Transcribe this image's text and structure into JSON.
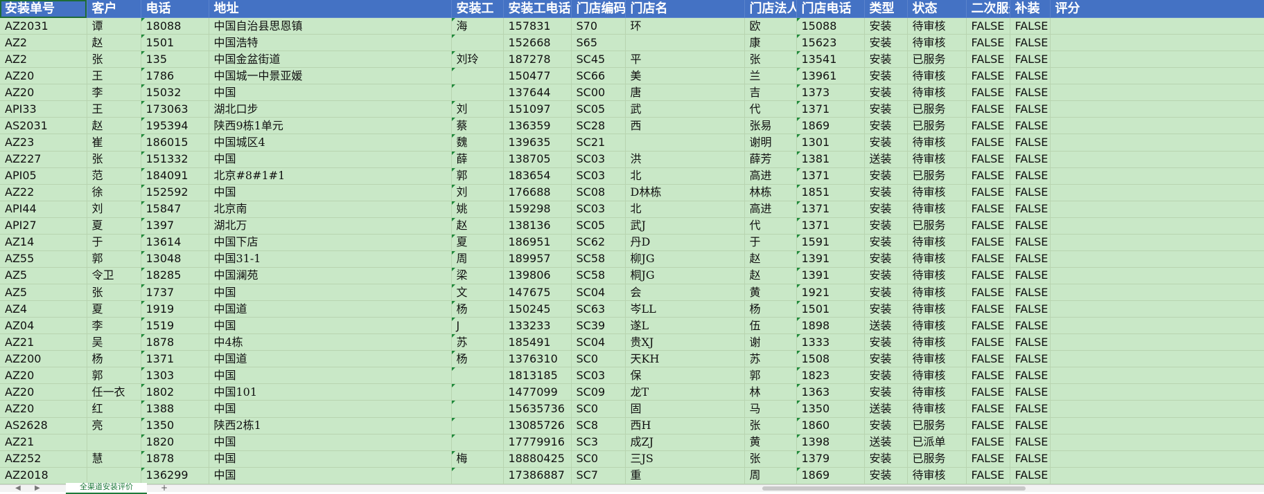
{
  "columns": [
    {
      "key": "order_no",
      "label": "安装单号"
    },
    {
      "key": "customer",
      "label": "客户"
    },
    {
      "key": "phone",
      "label": "电话"
    },
    {
      "key": "address",
      "label": "地址"
    },
    {
      "key": "installer",
      "label": "安装工"
    },
    {
      "key": "installer_phone",
      "label": "安装工电话"
    },
    {
      "key": "store_code",
      "label": "门店编码"
    },
    {
      "key": "store_name",
      "label": "门店名"
    },
    {
      "key": "legal_person",
      "label": "门店法人"
    },
    {
      "key": "store_phone",
      "label": "门店电话"
    },
    {
      "key": "type",
      "label": "类型"
    },
    {
      "key": "status",
      "label": "状态"
    },
    {
      "key": "second_service",
      "label": "二次服务"
    },
    {
      "key": "supplement",
      "label": "补装"
    },
    {
      "key": "rating",
      "label": "评分"
    }
  ],
  "rows": [
    {
      "order_no": "AZ2031",
      "customer": "谭",
      "phone": "18088",
      "address": "中国自治县思恩镇",
      "installer": "海",
      "installer_phone": "157831",
      "store_code": "S70",
      "store_name": "环",
      "legal_person": "欧",
      "store_phone": "15088",
      "type": "安装",
      "status": "待审核",
      "second_service": "FALSE",
      "supplement": "FALSE",
      "rating": ""
    },
    {
      "order_no": "AZ2",
      "customer": "赵",
      "phone": "1501",
      "address": "中国浩特",
      "installer": "",
      "installer_phone": "152668",
      "store_code": "S65",
      "store_name": "",
      "legal_person": "康",
      "store_phone": "15623",
      "type": "安装",
      "status": "待审核",
      "second_service": "FALSE",
      "supplement": "FALSE",
      "rating": ""
    },
    {
      "order_no": "AZ2",
      "customer": "张",
      "phone": "135",
      "address": "中国金盆街道",
      "installer": "刘玲",
      "installer_phone": "187278",
      "store_code": "SC45",
      "store_name": "平",
      "legal_person": "张",
      "store_phone": "13541",
      "type": "安装",
      "status": "已服务",
      "second_service": "FALSE",
      "supplement": "FALSE",
      "rating": ""
    },
    {
      "order_no": "AZ20",
      "customer": "王",
      "phone": "1786",
      "address": "中国城一中景亚媛",
      "installer": "",
      "installer_phone": "150477",
      "store_code": "SC66",
      "store_name": "美",
      "legal_person": "兰",
      "store_phone": "13961",
      "type": "安装",
      "status": "待审核",
      "second_service": "FALSE",
      "supplement": "FALSE",
      "rating": ""
    },
    {
      "order_no": "AZ20",
      "customer": "李",
      "phone": "15032",
      "address": "中国",
      "installer": "",
      "installer_phone": "137644",
      "store_code": "SC00",
      "store_name": "唐",
      "legal_person": "吉",
      "store_phone": "1373",
      "type": "安装",
      "status": "待审核",
      "second_service": "FALSE",
      "supplement": "FALSE",
      "rating": ""
    },
    {
      "order_no": "API33",
      "customer": "王",
      "phone": "173063",
      "address": "湖北口步",
      "installer": "刘",
      "installer_phone": "151097",
      "store_code": "SC05",
      "store_name": "武",
      "legal_person": "代",
      "store_phone": "1371",
      "type": "安装",
      "status": "已服务",
      "second_service": "FALSE",
      "supplement": "FALSE",
      "rating": ""
    },
    {
      "order_no": "AS2031",
      "customer": "赵",
      "phone": "195394",
      "address": "陕西9栋1单元",
      "installer": "蔡",
      "installer_phone": "136359",
      "store_code": "SC28",
      "store_name": "西",
      "legal_person": "张易",
      "store_phone": "1869",
      "type": "安装",
      "status": "已服务",
      "second_service": "FALSE",
      "supplement": "FALSE",
      "rating": ""
    },
    {
      "order_no": "AZ23",
      "customer": "崔",
      "phone": "186015",
      "address": "中国城区4",
      "installer": "魏",
      "installer_phone": "139635",
      "store_code": "SC21",
      "store_name": "",
      "legal_person": "谢明",
      "store_phone": "1301",
      "type": "安装",
      "status": "待审核",
      "second_service": "FALSE",
      "supplement": "FALSE",
      "rating": ""
    },
    {
      "order_no": "AZ227",
      "customer": "张",
      "phone": "151332",
      "address": "中国",
      "installer": "薛",
      "installer_phone": "138705",
      "store_code": "SC03",
      "store_name": "洪",
      "legal_person": "薛芳",
      "store_phone": "1381",
      "type": "送装",
      "status": "待审核",
      "second_service": "FALSE",
      "supplement": "FALSE",
      "rating": ""
    },
    {
      "order_no": "API05",
      "customer": "范",
      "phone": "184091",
      "address": "北京#8#1#1",
      "installer": "郭",
      "installer_phone": "183654",
      "store_code": "SC03",
      "store_name": "北",
      "legal_person": "高进",
      "store_phone": "1371",
      "type": "安装",
      "status": "已服务",
      "second_service": "FALSE",
      "supplement": "FALSE",
      "rating": ""
    },
    {
      "order_no": "AZ22",
      "customer": "徐",
      "phone": "152592",
      "address": "中国",
      "installer": "刘",
      "installer_phone": "176688",
      "store_code": "SC08",
      "store_name": "D林栋",
      "legal_person": "林栋",
      "store_phone": "1851",
      "type": "安装",
      "status": "待审核",
      "second_service": "FALSE",
      "supplement": "FALSE",
      "rating": ""
    },
    {
      "order_no": "API44",
      "customer": "刘",
      "phone": "15847",
      "address": "北京南",
      "installer": "姚",
      "installer_phone": "159298",
      "store_code": "SC03",
      "store_name": "北",
      "legal_person": "高进",
      "store_phone": "1371",
      "type": "安装",
      "status": "待审核",
      "second_service": "FALSE",
      "supplement": "FALSE",
      "rating": ""
    },
    {
      "order_no": "API27",
      "customer": "夏",
      "phone": "1397",
      "address": "湖北万",
      "installer": "赵",
      "installer_phone": "138136",
      "store_code": "SC05",
      "store_name": "武J",
      "legal_person": "代",
      "store_phone": "1371",
      "type": "安装",
      "status": "已服务",
      "second_service": "FALSE",
      "supplement": "FALSE",
      "rating": ""
    },
    {
      "order_no": "AZ14",
      "customer": "于",
      "phone": "13614",
      "address": "中国下店",
      "installer": "夏",
      "installer_phone": "186951",
      "store_code": "SC62",
      "store_name": "丹D",
      "legal_person": "于",
      "store_phone": "1591",
      "type": "安装",
      "status": "待审核",
      "second_service": "FALSE",
      "supplement": "FALSE",
      "rating": ""
    },
    {
      "order_no": "AZ55",
      "customer": "郭",
      "phone": "13048",
      "address": "中国31-1",
      "installer": "周",
      "installer_phone": "189957",
      "store_code": "SC58",
      "store_name": "柳JG",
      "legal_person": "赵",
      "store_phone": "1391",
      "type": "安装",
      "status": "待审核",
      "second_service": "FALSE",
      "supplement": "FALSE",
      "rating": ""
    },
    {
      "order_no": "AZ5",
      "customer": "令卫",
      "phone": "18285",
      "address": "中国澜苑",
      "installer": "梁",
      "installer_phone": "139806",
      "store_code": "SC58",
      "store_name": "桐JG",
      "legal_person": "赵",
      "store_phone": "1391",
      "type": "安装",
      "status": "待审核",
      "second_service": "FALSE",
      "supplement": "FALSE",
      "rating": ""
    },
    {
      "order_no": "AZ5",
      "customer": "张",
      "phone": "1737",
      "address": "中国",
      "installer": "文",
      "installer_phone": "147675",
      "store_code": "SC04",
      "store_name": "会",
      "legal_person": "黄",
      "store_phone": "1921",
      "type": "安装",
      "status": "待审核",
      "second_service": "FALSE",
      "supplement": "FALSE",
      "rating": ""
    },
    {
      "order_no": "AZ4",
      "customer": "夏",
      "phone": "1919",
      "address": "中国道",
      "installer": "杨",
      "installer_phone": "150245",
      "store_code": "SC63",
      "store_name": "岑LL",
      "legal_person": "杨",
      "store_phone": "1501",
      "type": "安装",
      "status": "待审核",
      "second_service": "FALSE",
      "supplement": "FALSE",
      "rating": ""
    },
    {
      "order_no": "AZ04",
      "customer": "李",
      "phone": "1519",
      "address": "中国",
      "installer": "J",
      "installer_phone": "133233",
      "store_code": "SC39",
      "store_name": "遂L",
      "legal_person": "伍",
      "store_phone": "1898",
      "type": "送装",
      "status": "待审核",
      "second_service": "FALSE",
      "supplement": "FALSE",
      "rating": ""
    },
    {
      "order_no": "AZ21",
      "customer": "吴",
      "phone": "1878",
      "address": "中4栋",
      "installer": "苏",
      "installer_phone": "185491",
      "store_code": "SC04",
      "store_name": "贵XJ",
      "legal_person": "谢",
      "store_phone": "1333",
      "type": "安装",
      "status": "待审核",
      "second_service": "FALSE",
      "supplement": "FALSE",
      "rating": ""
    },
    {
      "order_no": "AZ200",
      "customer": "杨",
      "phone": "1371",
      "address": "中国道",
      "installer": "杨",
      "installer_phone": "1376310",
      "store_code": "SC0",
      "store_name": "天KH",
      "legal_person": "苏",
      "store_phone": "1508",
      "type": "安装",
      "status": "待审核",
      "second_service": "FALSE",
      "supplement": "FALSE",
      "rating": ""
    },
    {
      "order_no": "AZ20",
      "customer": "郭",
      "phone": "1303",
      "address": "中国",
      "installer": "",
      "installer_phone": "1813185",
      "store_code": "SC03",
      "store_name": "保",
      "legal_person": "郭",
      "store_phone": "1823",
      "type": "安装",
      "status": "待审核",
      "second_service": "FALSE",
      "supplement": "FALSE",
      "rating": ""
    },
    {
      "order_no": "AZ20",
      "customer": "任一衣",
      "phone": "1802",
      "address": "中国101",
      "installer": "",
      "installer_phone": "1477099",
      "store_code": "SC09",
      "store_name": "龙T",
      "legal_person": "林",
      "store_phone": "1363",
      "type": "安装",
      "status": "待审核",
      "second_service": "FALSE",
      "supplement": "FALSE",
      "rating": ""
    },
    {
      "order_no": "AZ20",
      "customer": "红",
      "phone": "1388",
      "address": "中国",
      "installer": "",
      "installer_phone": "15635736",
      "store_code": "SC0",
      "store_name": "固",
      "legal_person": "马",
      "store_phone": "1350",
      "type": "送装",
      "status": "待审核",
      "second_service": "FALSE",
      "supplement": "FALSE",
      "rating": ""
    },
    {
      "order_no": "AS2628",
      "customer": "亮",
      "phone": "1350",
      "address": "陕西2栋1",
      "installer": "",
      "installer_phone": "13085726",
      "store_code": "SC8",
      "store_name": "西H",
      "legal_person": "张",
      "store_phone": "1860",
      "type": "安装",
      "status": "已服务",
      "second_service": "FALSE",
      "supplement": "FALSE",
      "rating": ""
    },
    {
      "order_no": "AZ21",
      "customer": "",
      "phone": "1820",
      "address": "中国",
      "installer": "",
      "installer_phone": "17779916",
      "store_code": "SC3",
      "store_name": "成ZJ",
      "legal_person": "黄",
      "store_phone": "1398",
      "type": "送装",
      "status": "已派单",
      "second_service": "FALSE",
      "supplement": "FALSE",
      "rating": ""
    },
    {
      "order_no": "AZ252",
      "customer": "慧",
      "phone": "1878",
      "address": "中国",
      "installer": "梅",
      "installer_phone": "18880425",
      "store_code": "SC0",
      "store_name": "三JS",
      "legal_person": "张",
      "store_phone": "1379",
      "type": "安装",
      "status": "已服务",
      "second_service": "FALSE",
      "supplement": "FALSE",
      "rating": ""
    },
    {
      "order_no": "AZ2018",
      "customer": "",
      "phone": "136299",
      "address": "中国",
      "installer": "",
      "installer_phone": "17386887",
      "store_code": "SC7",
      "store_name": "重",
      "legal_person": "周",
      "store_phone": "1869",
      "type": "安装",
      "status": "待审核",
      "second_service": "FALSE",
      "supplement": "FALSE",
      "rating": ""
    }
  ],
  "sheet_tab": "全渠道安装评价",
  "add_sheet_glyph": "+",
  "nav_prev_glyph": "◀",
  "nav_next_glyph": "▶"
}
